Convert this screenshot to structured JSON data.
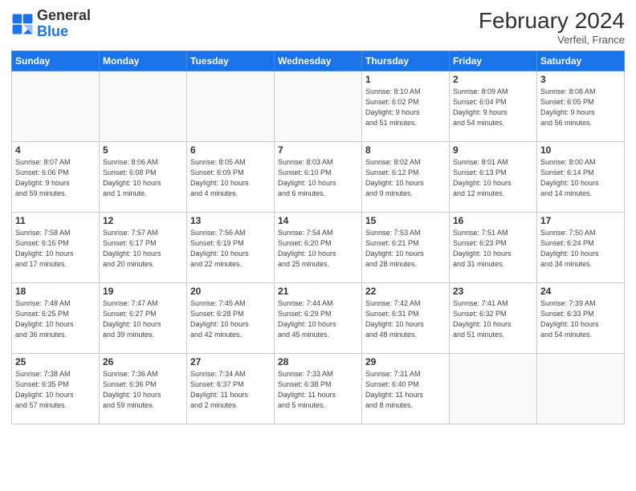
{
  "header": {
    "logo_general": "General",
    "logo_blue": "Blue",
    "month_title": "February 2024",
    "subtitle": "Verfeil, France"
  },
  "weekdays": [
    "Sunday",
    "Monday",
    "Tuesday",
    "Wednesday",
    "Thursday",
    "Friday",
    "Saturday"
  ],
  "weeks": [
    [
      {
        "num": "",
        "info": ""
      },
      {
        "num": "",
        "info": ""
      },
      {
        "num": "",
        "info": ""
      },
      {
        "num": "",
        "info": ""
      },
      {
        "num": "1",
        "info": "Sunrise: 8:10 AM\nSunset: 6:02 PM\nDaylight: 9 hours\nand 51 minutes."
      },
      {
        "num": "2",
        "info": "Sunrise: 8:09 AM\nSunset: 6:04 PM\nDaylight: 9 hours\nand 54 minutes."
      },
      {
        "num": "3",
        "info": "Sunrise: 8:08 AM\nSunset: 6:05 PM\nDaylight: 9 hours\nand 56 minutes."
      }
    ],
    [
      {
        "num": "4",
        "info": "Sunrise: 8:07 AM\nSunset: 6:06 PM\nDaylight: 9 hours\nand 59 minutes."
      },
      {
        "num": "5",
        "info": "Sunrise: 8:06 AM\nSunset: 6:08 PM\nDaylight: 10 hours\nand 1 minute."
      },
      {
        "num": "6",
        "info": "Sunrise: 8:05 AM\nSunset: 6:09 PM\nDaylight: 10 hours\nand 4 minutes."
      },
      {
        "num": "7",
        "info": "Sunrise: 8:03 AM\nSunset: 6:10 PM\nDaylight: 10 hours\nand 6 minutes."
      },
      {
        "num": "8",
        "info": "Sunrise: 8:02 AM\nSunset: 6:12 PM\nDaylight: 10 hours\nand 9 minutes."
      },
      {
        "num": "9",
        "info": "Sunrise: 8:01 AM\nSunset: 6:13 PM\nDaylight: 10 hours\nand 12 minutes."
      },
      {
        "num": "10",
        "info": "Sunrise: 8:00 AM\nSunset: 6:14 PM\nDaylight: 10 hours\nand 14 minutes."
      }
    ],
    [
      {
        "num": "11",
        "info": "Sunrise: 7:58 AM\nSunset: 6:16 PM\nDaylight: 10 hours\nand 17 minutes."
      },
      {
        "num": "12",
        "info": "Sunrise: 7:57 AM\nSunset: 6:17 PM\nDaylight: 10 hours\nand 20 minutes."
      },
      {
        "num": "13",
        "info": "Sunrise: 7:56 AM\nSunset: 6:19 PM\nDaylight: 10 hours\nand 22 minutes."
      },
      {
        "num": "14",
        "info": "Sunrise: 7:54 AM\nSunset: 6:20 PM\nDaylight: 10 hours\nand 25 minutes."
      },
      {
        "num": "15",
        "info": "Sunrise: 7:53 AM\nSunset: 6:21 PM\nDaylight: 10 hours\nand 28 minutes."
      },
      {
        "num": "16",
        "info": "Sunrise: 7:51 AM\nSunset: 6:23 PM\nDaylight: 10 hours\nand 31 minutes."
      },
      {
        "num": "17",
        "info": "Sunrise: 7:50 AM\nSunset: 6:24 PM\nDaylight: 10 hours\nand 34 minutes."
      }
    ],
    [
      {
        "num": "18",
        "info": "Sunrise: 7:48 AM\nSunset: 6:25 PM\nDaylight: 10 hours\nand 36 minutes."
      },
      {
        "num": "19",
        "info": "Sunrise: 7:47 AM\nSunset: 6:27 PM\nDaylight: 10 hours\nand 39 minutes."
      },
      {
        "num": "20",
        "info": "Sunrise: 7:45 AM\nSunset: 6:28 PM\nDaylight: 10 hours\nand 42 minutes."
      },
      {
        "num": "21",
        "info": "Sunrise: 7:44 AM\nSunset: 6:29 PM\nDaylight: 10 hours\nand 45 minutes."
      },
      {
        "num": "22",
        "info": "Sunrise: 7:42 AM\nSunset: 6:31 PM\nDaylight: 10 hours\nand 48 minutes."
      },
      {
        "num": "23",
        "info": "Sunrise: 7:41 AM\nSunset: 6:32 PM\nDaylight: 10 hours\nand 51 minutes."
      },
      {
        "num": "24",
        "info": "Sunrise: 7:39 AM\nSunset: 6:33 PM\nDaylight: 10 hours\nand 54 minutes."
      }
    ],
    [
      {
        "num": "25",
        "info": "Sunrise: 7:38 AM\nSunset: 6:35 PM\nDaylight: 10 hours\nand 57 minutes."
      },
      {
        "num": "26",
        "info": "Sunrise: 7:36 AM\nSunset: 6:36 PM\nDaylight: 10 hours\nand 59 minutes."
      },
      {
        "num": "27",
        "info": "Sunrise: 7:34 AM\nSunset: 6:37 PM\nDaylight: 11 hours\nand 2 minutes."
      },
      {
        "num": "28",
        "info": "Sunrise: 7:33 AM\nSunset: 6:38 PM\nDaylight: 11 hours\nand 5 minutes."
      },
      {
        "num": "29",
        "info": "Sunrise: 7:31 AM\nSunset: 6:40 PM\nDaylight: 11 hours\nand 8 minutes."
      },
      {
        "num": "",
        "info": ""
      },
      {
        "num": "",
        "info": ""
      }
    ]
  ]
}
